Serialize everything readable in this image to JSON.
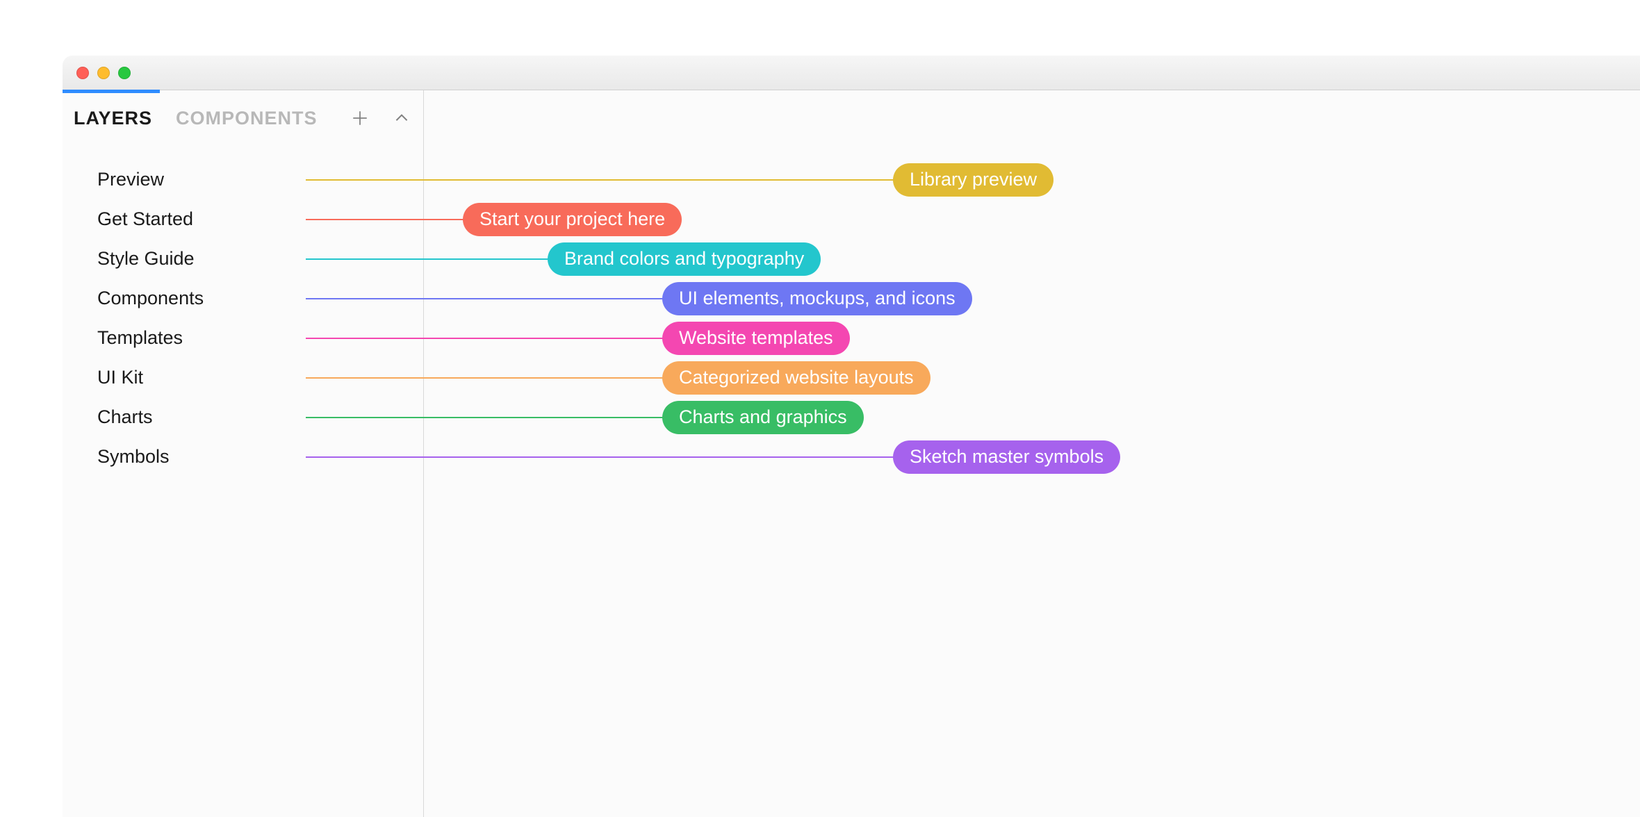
{
  "tabs": {
    "layers": "LAYERS",
    "components": "COMPONENTS"
  },
  "layers": [
    {
      "name": "Preview",
      "pill": "Library preview",
      "color": "#e1bb33",
      "pillLeft": 1195,
      "lineStart": 350
    },
    {
      "name": "Get Started",
      "pill": "Start your project here",
      "color": "#f86b5a",
      "pillLeft": 576,
      "lineStart": 350
    },
    {
      "name": "Style Guide",
      "pill": "Brand colors and typography",
      "color": "#23c6cd",
      "pillLeft": 698,
      "lineStart": 350
    },
    {
      "name": "Components",
      "pill": "UI elements, mockups, and icons",
      "color": "#6e77f3",
      "pillLeft": 863,
      "lineStart": 350
    },
    {
      "name": "Templates",
      "pill": "Website templates",
      "color": "#f447b1",
      "pillLeft": 863,
      "lineStart": 350
    },
    {
      "name": "UI Kit",
      "pill": "Categorized website layouts",
      "color": "#f8a95b",
      "pillLeft": 863,
      "lineStart": 350
    },
    {
      "name": "Charts",
      "pill": "Charts and graphics",
      "color": "#38bd65",
      "pillLeft": 863,
      "lineStart": 350
    },
    {
      "name": "Symbols",
      "pill": "Sketch master symbols",
      "color": "#a662ed",
      "pillLeft": 1195,
      "lineStart": 350
    }
  ]
}
